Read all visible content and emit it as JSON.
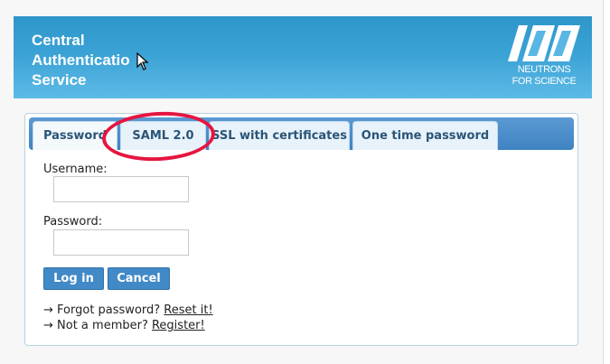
{
  "header": {
    "title_lines": [
      "Central",
      "Authenticatio",
      "Service"
    ],
    "logo_lines": [
      "NEUTRONS",
      "FOR SCIENCE"
    ],
    "logo_icon": "ill-logo-icon"
  },
  "tabs": [
    {
      "label": "Password",
      "active": true
    },
    {
      "label": "SAML 2.0",
      "active": false
    },
    {
      "label": "SSL with certificates",
      "active": false
    },
    {
      "label": "One time password",
      "active": false
    }
  ],
  "form": {
    "username_label": "Username:",
    "username_value": "",
    "password_label": "Password:",
    "password_value": "",
    "login_label": "Log in",
    "cancel_label": "Cancel"
  },
  "links": {
    "forgot_prefix": "→ Forgot password? ",
    "forgot_link": "Reset it!",
    "member_prefix": "→ Not a member? ",
    "member_link": "Register!"
  },
  "colors": {
    "header_blue": "#3aa2d5",
    "tabbar_blue": "#4a8cc7",
    "button_blue": "#4189c7",
    "highlight_red": "#e51640"
  }
}
